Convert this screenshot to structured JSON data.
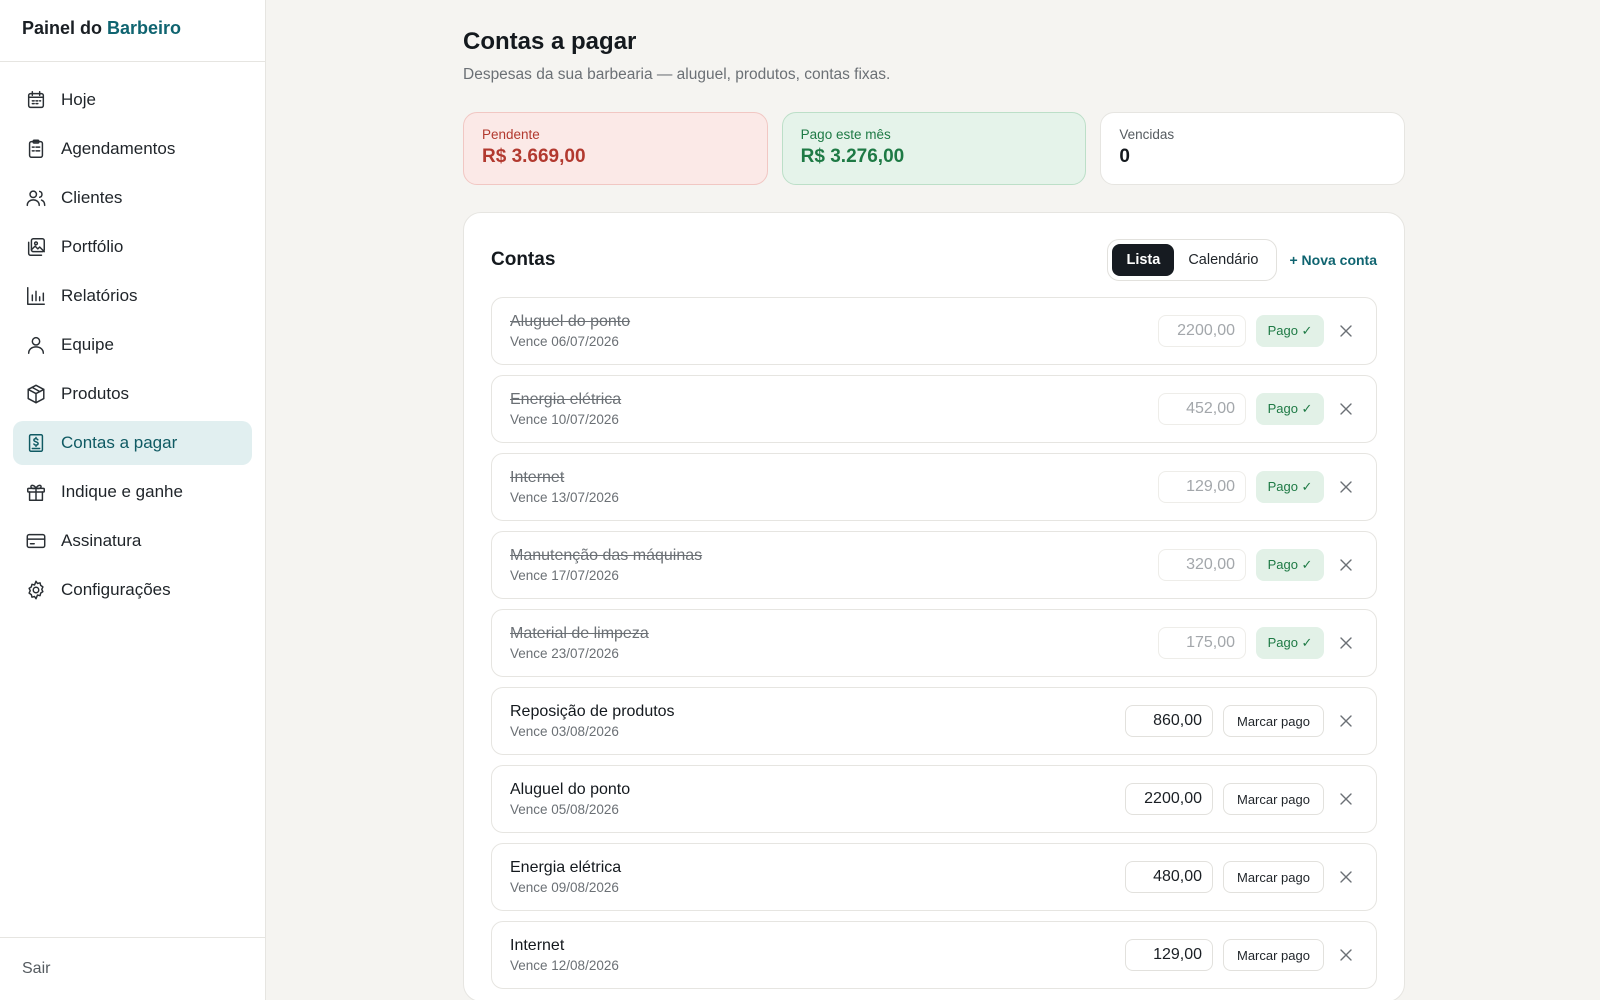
{
  "brand": {
    "prefix": "Painel do",
    "accent": "Barbeiro"
  },
  "nav": [
    {
      "label": "Hoje",
      "icon": "calendar-icon",
      "active": false
    },
    {
      "label": "Agendamentos",
      "icon": "clipboard-icon",
      "active": false
    },
    {
      "label": "Clientes",
      "icon": "users-icon",
      "active": false
    },
    {
      "label": "Portfólio",
      "icon": "gallery-icon",
      "active": false
    },
    {
      "label": "Relatórios",
      "icon": "bar-chart-icon",
      "active": false
    },
    {
      "label": "Equipe",
      "icon": "user-icon",
      "active": false
    },
    {
      "label": "Produtos",
      "icon": "box-icon",
      "active": false
    },
    {
      "label": "Contas a pagar",
      "icon": "receipt-dollar-icon",
      "active": true
    },
    {
      "label": "Indique e ganhe",
      "icon": "gift-icon",
      "active": false
    },
    {
      "label": "Assinatura",
      "icon": "credit-card-icon",
      "active": false
    },
    {
      "label": "Configurações",
      "icon": "gear-icon",
      "active": false
    }
  ],
  "sidebar_footer": {
    "logout": "Sair"
  },
  "header": {
    "title": "Contas a pagar",
    "subtitle": "Despesas da sua barbearia — aluguel, produtos, contas fixas."
  },
  "summary": {
    "pending": {
      "label": "Pendente",
      "value": "R$ 3.669,00"
    },
    "paid": {
      "label": "Pago este mês",
      "value": "R$ 3.276,00"
    },
    "overdue": {
      "label": "Vencidas",
      "value": "0"
    }
  },
  "panel": {
    "title": "Contas",
    "view_list": "Lista",
    "view_calendar": "Calendário",
    "new_bill": "+ Nova conta",
    "paid_label": "Pago ✓",
    "mark_paid_label": "Marcar pago"
  },
  "bills": [
    {
      "name": "Aluguel do ponto",
      "due": "Vence 06/07/2026",
      "amount": "2200,00",
      "paid": true
    },
    {
      "name": "Energia elétrica",
      "due": "Vence 10/07/2026",
      "amount": "452,00",
      "paid": true
    },
    {
      "name": "Internet",
      "due": "Vence 13/07/2026",
      "amount": "129,00",
      "paid": true
    },
    {
      "name": "Manutenção das máquinas",
      "due": "Vence 17/07/2026",
      "amount": "320,00",
      "paid": true
    },
    {
      "name": "Material de limpeza",
      "due": "Vence 23/07/2026",
      "amount": "175,00",
      "paid": true
    },
    {
      "name": "Reposição de produtos",
      "due": "Vence 03/08/2026",
      "amount": "860,00",
      "paid": false
    },
    {
      "name": "Aluguel do ponto",
      "due": "Vence 05/08/2026",
      "amount": "2200,00",
      "paid": false
    },
    {
      "name": "Energia elétrica",
      "due": "Vence 09/08/2026",
      "amount": "480,00",
      "paid": false
    },
    {
      "name": "Internet",
      "due": "Vence 12/08/2026",
      "amount": "129,00",
      "paid": false
    }
  ]
}
